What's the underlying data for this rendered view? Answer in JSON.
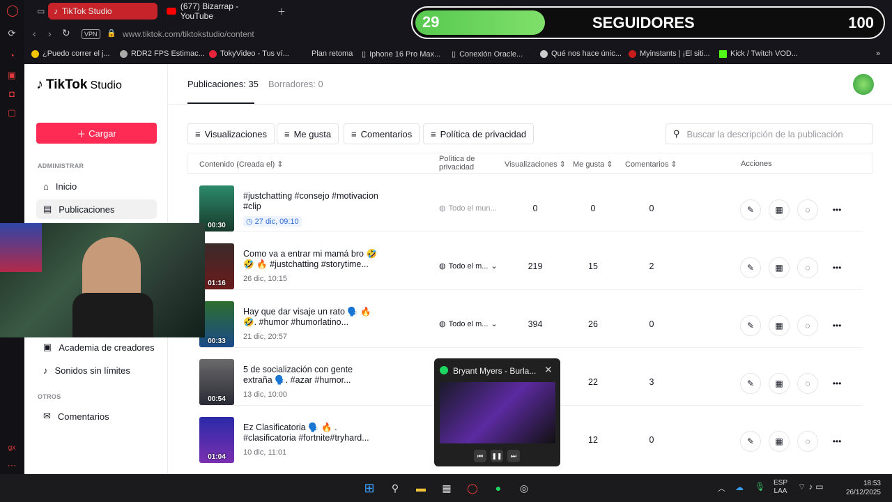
{
  "browser": {
    "tabs": [
      {
        "label": "TikTok Studio",
        "active": true
      },
      {
        "label": "(677) Bizarrap - YouTube",
        "active": false
      }
    ],
    "address": {
      "vpn": "VPN",
      "url_host": "www.tiktok.com",
      "url_path": "/tiktokstudio/content"
    },
    "bookmarks": [
      "¿Puedo correr el j...",
      "RDR2 FPS Estimac...",
      "TokyVideo - Tus ví...",
      "Plan retoma",
      "Iphone 16 Pro Max...",
      "Conexión Oracle...",
      "Qué nos hace únic...",
      "Myinstants | ¡El siti...",
      "Kick / Twitch VOD..."
    ]
  },
  "overlay": {
    "count": "29",
    "label": "SEGUIDORES",
    "goal": "100",
    "progress": 0.29
  },
  "studio": {
    "logo_main": "TikTok",
    "logo_sub": "Studio",
    "upload_label": "Cargar",
    "nav_section_admin": "ADMINISTRAR",
    "nav_section_other": "OTROS",
    "nav": {
      "home": "Inicio",
      "posts": "Publicaciones",
      "academy": "Academia de creadores",
      "sounds": "Sonidos sin límites",
      "comments": "Comentarios"
    },
    "tabs": {
      "published": "Publicaciones: 35",
      "drafts": "Borradores: 0"
    },
    "filters": [
      "Visualizaciones",
      "Me gusta",
      "Comentarios",
      "Política de privacidad"
    ],
    "search_placeholder": "Buscar la descripción de la publicación",
    "columns": {
      "content": "Contenido (Creada el)",
      "privacy": "Política de privacidad",
      "views": "Visualizaciones",
      "likes": "Me gusta",
      "comments": "Comentarios",
      "actions": "Acciones"
    },
    "rows": [
      {
        "desc": "#justchatting #consejo #motivacion #clip",
        "date": "27 dic, 09:10",
        "duration": "00:30",
        "privacy": "Todo el mun...",
        "views": "0",
        "likes": "0",
        "comments": "0"
      },
      {
        "desc": "Como va a entrar mi mamá bro 🤣 🤣 🔥 #justchatting #storytime...",
        "date": "26 dic, 10:15",
        "duration": "01:16",
        "privacy": "Todo el m...",
        "views": "219",
        "likes": "15",
        "comments": "2"
      },
      {
        "desc": "Hay que dar visaje un rato 🗣️ 🔥 🤣. #humor #humorlatino...",
        "date": "21 dic, 20:57",
        "duration": "00:33",
        "privacy": "Todo el m...",
        "views": "394",
        "likes": "26",
        "comments": "0"
      },
      {
        "desc": "5 de socialización con gente extraña 🗣️. #azar #humor...",
        "date": "13 dic, 10:00",
        "duration": "00:54",
        "privacy": "",
        "views": "",
        "likes": "22",
        "comments": "3"
      },
      {
        "desc": "Ez Clasificatoria 🗣️ 🔥 . #clasificatoria #fortnite#tryhard...",
        "date": "10 dic, 11:01",
        "duration": "01:04",
        "privacy": "",
        "views": "",
        "likes": "12",
        "comments": "0"
      }
    ]
  },
  "spotify": {
    "title": "Bryant Myers - Burla..."
  },
  "tray": {
    "lang1": "ESP",
    "lang2": "LAA",
    "time": "18:53",
    "date": "26/12/2025"
  },
  "colors": {
    "accent": "#fe2c55",
    "opera": "#c6242a",
    "overlay_fill": "#57c94f"
  }
}
